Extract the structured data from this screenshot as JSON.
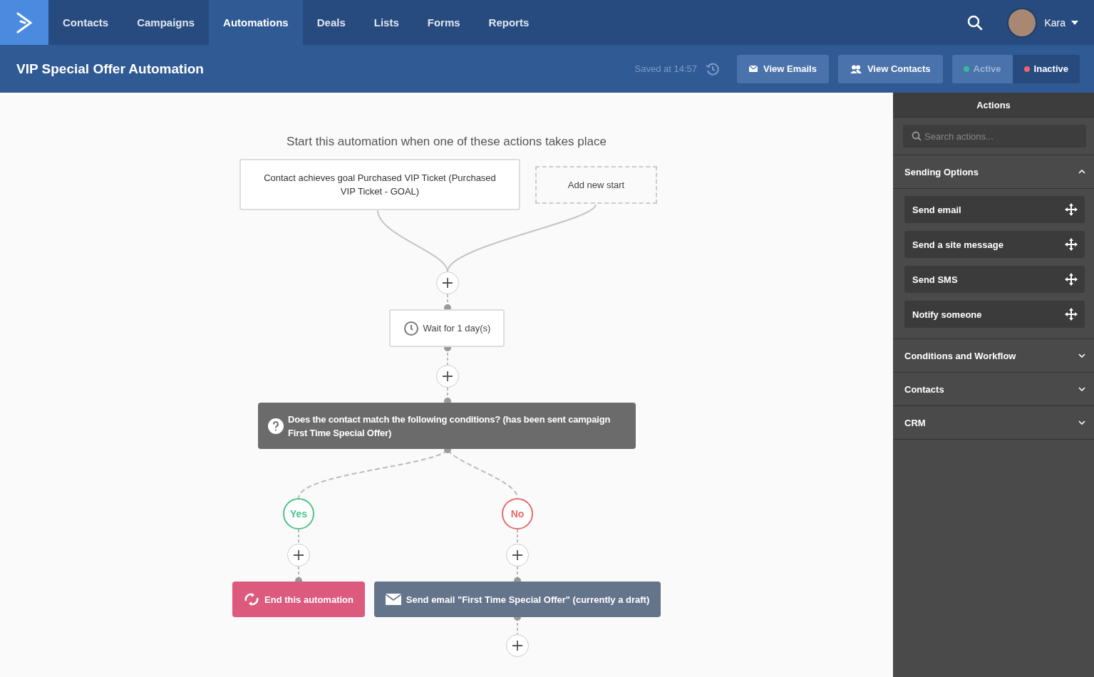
{
  "nav": {
    "items": [
      {
        "label": "Contacts",
        "selected": false
      },
      {
        "label": "Campaigns",
        "selected": false
      },
      {
        "label": "Automations",
        "selected": true
      },
      {
        "label": "Deals",
        "selected": false
      },
      {
        "label": "Lists",
        "selected": false
      },
      {
        "label": "Forms",
        "selected": false
      },
      {
        "label": "Reports",
        "selected": false
      }
    ],
    "user": {
      "name": "Kara"
    }
  },
  "header": {
    "title": "VIP Special Offer Automation",
    "saved": "Saved at 14:57",
    "buttons": [
      {
        "label": "View Emails",
        "kind": "emails"
      },
      {
        "label": "View Contacts",
        "kind": "contacts"
      }
    ],
    "status": [
      {
        "label": "Active",
        "selected": false,
        "color": "#3bb89a"
      },
      {
        "label": "Inactive",
        "selected": true,
        "color": "#f0636a"
      }
    ]
  },
  "canvas": {
    "prompt": "Start this automation when one of these actions takes place",
    "triggers": [
      {
        "kind": "trigger",
        "text": "Contact achieves goal Purchased VIP Ticket (Purchased VIP Ticket - GOAL)"
      },
      {
        "kind": "add",
        "text": "Add new start"
      }
    ],
    "wait": "Wait for 1 day(s)",
    "condition": "Does the contact match the following conditions? (has been sent campaign First Time Special Offer)",
    "branches": [
      {
        "label": "Yes",
        "color": "#4cc38a",
        "action": {
          "kind": "end",
          "text": "End this automation"
        }
      },
      {
        "label": "No",
        "color": "#e8696b",
        "action": {
          "kind": "email",
          "text": "Send email \"First Time Special Offer\" (currently a draft)"
        }
      }
    ]
  },
  "sidebar": {
    "title": "Actions",
    "search": {
      "placeholder": "Search actions..."
    },
    "sections": [
      {
        "label": "Sending Options",
        "expanded": true,
        "items": [
          "Send email",
          "Send a site message",
          "Send SMS",
          "Notify someone"
        ]
      },
      {
        "label": "Conditions and Workflow",
        "expanded": false
      },
      {
        "label": "Contacts",
        "expanded": false
      },
      {
        "label": "CRM",
        "expanded": false
      }
    ]
  }
}
